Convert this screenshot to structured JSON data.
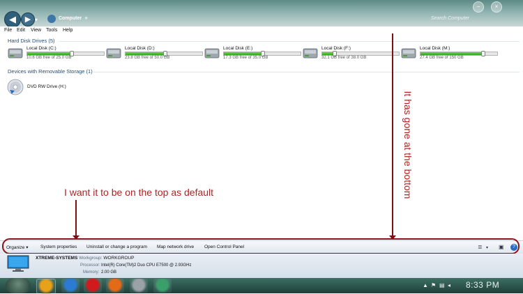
{
  "titlebar": {
    "address": "Computer",
    "search_placeholder": "Search Computer",
    "back_glyph": "◀",
    "forward_glyph": "▶",
    "addr_plus": "+",
    "minimize_glyph": "−",
    "close_glyph": "×"
  },
  "menu": [
    "File",
    "Edit",
    "View",
    "Tools",
    "Help"
  ],
  "sections": {
    "hdd_title": "Hard Disk Drives (5)",
    "removable_title": "Devices with Removable Storage (1)"
  },
  "drives": [
    {
      "name": "Local Disk (C:)",
      "free": "10.6 GB free of 25.0 GB",
      "used_fraction": 0.58
    },
    {
      "name": "Local Disk (D:)",
      "free": "23.8 GB free of 50.0 GB",
      "used_fraction": 0.52
    },
    {
      "name": "Local Disk (E:)",
      "free": "17.3 GB free of 35.0 GB",
      "used_fraction": 0.51
    },
    {
      "name": "Local Disk (F:)",
      "free": "32.1 GB free of 38.0 GB",
      "used_fraction": 0.16
    },
    {
      "name": "Local Disk (M:)",
      "free": "27.4 GB free of 150 GB",
      "used_fraction": 0.82
    }
  ],
  "removable": {
    "name": "DVD RW Drive (H:)"
  },
  "annotations": {
    "left_note": "I want it to be on the top as default",
    "right_note": "It has gone at the bottom",
    "color": "#b22222"
  },
  "commandbar": {
    "organize": "Organize",
    "system_properties": "System properties",
    "uninstall": "Uninstall or change a program",
    "map_drive": "Map network drive",
    "control_panel": "Open Control Panel",
    "view_icon": "≣",
    "pane_icon": "▣",
    "help_icon": "?"
  },
  "details": {
    "computer_name": "XTREME-SYSTEMS",
    "workgroup_label": "Workgroup:",
    "workgroup_value": "WORKGROUP",
    "processor_label": "Processor:",
    "processor_value": "Intel(R) Core(TM)2 Duo CPU    E7500  @ 2.93GHz",
    "memory_label": "Memory:",
    "memory_value": "2.00 GB"
  },
  "taskbar": {
    "clock": "8:33 PM",
    "apps": [
      "explorer",
      "internet-explorer",
      "opera",
      "firefox",
      "chrome",
      "media-app"
    ],
    "app_colors": [
      "#e8a21a",
      "#2a7bd1",
      "#d2191c",
      "#e56a17",
      "#9aa2a8",
      "#3aa06b"
    ]
  }
}
